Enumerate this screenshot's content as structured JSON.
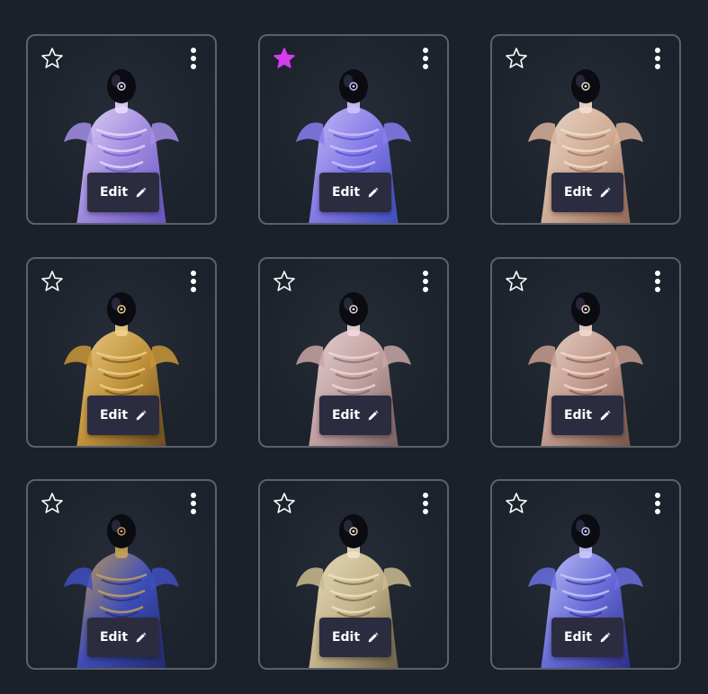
{
  "colors": {
    "background": "#1a212a",
    "card_border": "#5b6069",
    "edit_button_bg": "#2c2c40",
    "star_active": "#d63cf0",
    "star_inactive": "#ffffff"
  },
  "cards": [
    {
      "favorited": false,
      "edit_label": "Edit",
      "palette": [
        "#a58ee8",
        "#e9dcff",
        "#6a55c9"
      ]
    },
    {
      "favorited": true,
      "edit_label": "Edit",
      "palette": [
        "#8a7cf0",
        "#cfc4ff",
        "#3d4fc7"
      ]
    },
    {
      "favorited": false,
      "edit_label": "Edit",
      "palette": [
        "#d9b39a",
        "#f3dfd0",
        "#9a6c58"
      ]
    },
    {
      "favorited": false,
      "edit_label": "Edit",
      "palette": [
        "#c9973a",
        "#f1d28a",
        "#6e4d1e"
      ]
    },
    {
      "favorited": false,
      "edit_label": "Edit",
      "palette": [
        "#c9a6a6",
        "#efdada",
        "#7d6262"
      ]
    },
    {
      "favorited": false,
      "edit_label": "Edit",
      "palette": [
        "#c79d8e",
        "#f2d9cd",
        "#7a5548"
      ]
    },
    {
      "favorited": false,
      "edit_label": "Edit",
      "palette": [
        "#3f4fbf",
        "#c9a256",
        "#232b6e"
      ]
    },
    {
      "favorited": false,
      "edit_label": "Edit",
      "palette": [
        "#cdbb8f",
        "#f0e4c4",
        "#6f6245"
      ]
    },
    {
      "favorited": false,
      "edit_label": "Edit",
      "palette": [
        "#6a6fe0",
        "#c9c9ff",
        "#2f2f8f"
      ]
    }
  ]
}
